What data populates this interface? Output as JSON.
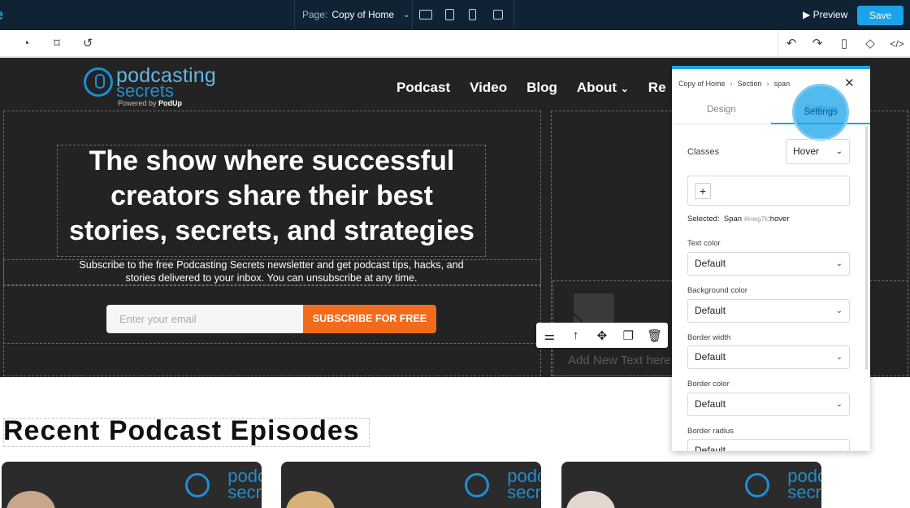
{
  "topbar": {
    "page_label": "Page:",
    "page_name": "Copy of Home",
    "preview_label": "Preview",
    "save_label": "Save"
  },
  "site": {
    "brand_line1": "podcasting",
    "brand_line2": "secrets",
    "powered_by": "Powered by",
    "powered_brand": "PodUp",
    "nav": [
      "Podcast",
      "Video",
      "Blog",
      "About",
      "Re"
    ],
    "headline": "The show where successful creators share their best stories, secrets, and strategies",
    "subheadline": "Subscribe to the free Podcasting Secrets newsletter and get podcast tips, hacks, and stories delivered to your inbox. You can unsubscribe at any time.",
    "email_placeholder": "Enter your email",
    "subscribe_label": "SUBSCRIBE FOR FREE",
    "add_text": "Add New Text here",
    "recent_heading": "Recent Podcast Episodes",
    "card_logo_line1": "podc",
    "card_logo_line2": "secr"
  },
  "panel": {
    "breadcrumb": [
      "Copy of Home",
      "Section",
      "span"
    ],
    "tabs": {
      "design": "Design",
      "settings": "Settings"
    },
    "classes_label": "Classes",
    "state_value": "Hover",
    "selected_label": "Selected:",
    "selected_tag": "Span",
    "selected_id": "#inwg7k",
    "selected_state": ":hover",
    "fields": [
      {
        "label": "Text color",
        "value": "Default"
      },
      {
        "label": "Background color",
        "value": "Default"
      },
      {
        "label": "Border width",
        "value": "Default"
      },
      {
        "label": "Border color",
        "value": "Default"
      },
      {
        "label": "Border radius",
        "value": "Default"
      }
    ]
  },
  "colors": {
    "accent": "#1aa3e8",
    "cta": "#f26b1d",
    "topbar": "#0f2334",
    "hero_bg": "#232323"
  }
}
